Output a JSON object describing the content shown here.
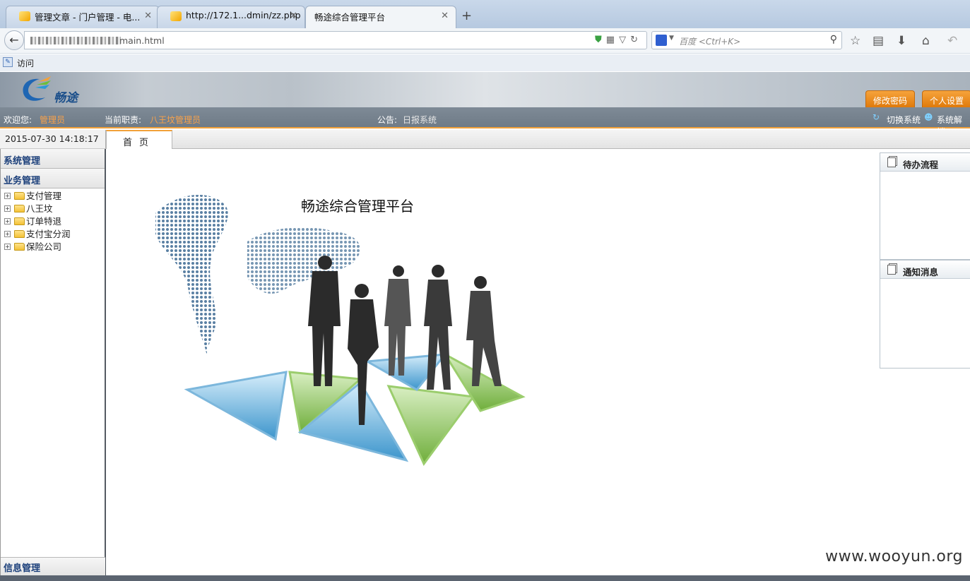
{
  "browser": {
    "tabs": [
      {
        "title": "管理文章 - 门户管理 - 电..."
      },
      {
        "title": "http://172.1...dmin/zz.php"
      },
      {
        "title": "畅途综合管理平台"
      }
    ],
    "url": "main.html",
    "search_placeholder": "百度 <Ctrl+K>",
    "bookmark_label": "访问"
  },
  "header": {
    "logo_text": "畅途",
    "change_password": "修改密码",
    "personal_settings": "个人设置"
  },
  "infobar": {
    "welcome_label": "欢迎您:",
    "user": "管理员",
    "role_label": "当前职责:",
    "role": "八王坟管理员",
    "notice_label": "公告:",
    "notice": "日报系统",
    "switch_system": "切换系统",
    "system_unlock": "系统解锁"
  },
  "datetime": "2015-07-30 14:18:17",
  "home_tab": "首页",
  "sidebar": {
    "sections": [
      "系统管理",
      "业务管理"
    ],
    "tree": [
      "支付管理",
      "八王坟",
      "订单特退",
      "支付宝分润",
      "保险公司"
    ],
    "footer": "信息管理"
  },
  "main": {
    "hero_title": "畅途综合管理平台"
  },
  "panels": {
    "todo": "待办流程",
    "notice": "通知消息"
  },
  "watermark": "www.wooyun.org",
  "colors": {
    "accent_orange": "#f2a13a",
    "highlight_text": "#f8a14a",
    "nav_blue": "#1b3f7a"
  }
}
